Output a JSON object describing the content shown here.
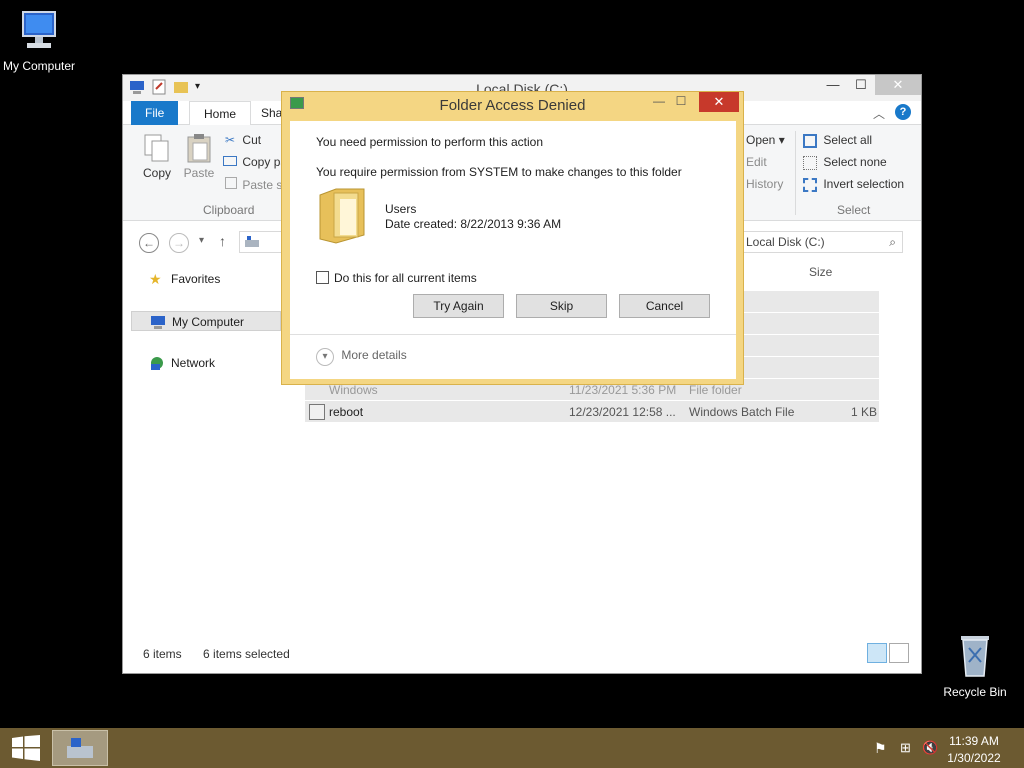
{
  "desktop": {
    "icons": [
      {
        "label": "My Computer"
      },
      {
        "label": "Recycle Bin"
      }
    ]
  },
  "explorer": {
    "title": "Local Disk (C:)",
    "window_buttons": {
      "minimize": "—",
      "maximize": "☐",
      "close": "✕"
    },
    "ribbon_tabs": {
      "file": "File",
      "home": "Home",
      "share": "Shar"
    },
    "clipboard": {
      "copy": "Copy",
      "paste": "Paste",
      "cut": "Cut",
      "copy_path": "Copy pa",
      "paste_shortcut": "Paste sh",
      "group_label": "Clipboard"
    },
    "open_group": {
      "open": "Open ▾",
      "edit": "Edit",
      "history": "History"
    },
    "select_group": {
      "select_all": "Select all",
      "select_none": "Select none",
      "invert": "Invert selection",
      "group_label": "Select"
    },
    "search_placeholder": "Local Disk (C:)",
    "nav": {
      "favorites": "Favorites",
      "my_computer": "My Computer",
      "network": "Network"
    },
    "columns": {
      "size": "Size"
    },
    "files": [
      {
        "name": "Windows",
        "date": "11/23/2021 5:36 PM",
        "type": "File folder",
        "size": ""
      },
      {
        "name": "reboot",
        "date": "12/23/2021 12:58 ...",
        "type": "Windows Batch File",
        "size": "1 KB"
      }
    ],
    "status": {
      "items": "6 items",
      "selected": "6 items selected"
    }
  },
  "dialog": {
    "title": "Folder Access Denied",
    "heading": "You need permission to perform this action",
    "message": "You require permission from SYSTEM to make changes to this folder",
    "folder_name": "Users",
    "folder_date": "Date created: 8/22/2013 9:36 AM",
    "checkbox_label": "Do this for all current items",
    "buttons": {
      "try_again": "Try Again",
      "skip": "Skip",
      "cancel": "Cancel"
    },
    "more_details": "More details",
    "window_buttons": {
      "minimize": "—",
      "maximize": "☐",
      "close": "✕"
    }
  },
  "taskbar": {
    "time": "11:39 AM",
    "date": "1/30/2022"
  },
  "colors": {
    "accent": "#1979ca",
    "dialog_frame": "#f4d683",
    "close_red": "#c7392b",
    "taskbar": "#6c5a31"
  }
}
